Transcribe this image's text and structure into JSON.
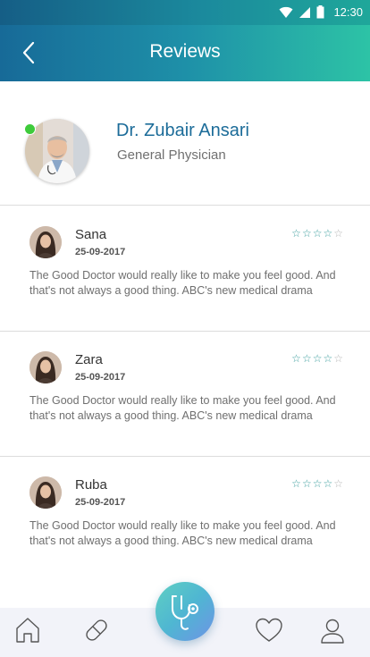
{
  "status_bar": {
    "time": "12:30",
    "icons": [
      "wifi-icon",
      "cell-signal-icon",
      "battery-icon"
    ]
  },
  "header": {
    "title": "Reviews",
    "back_icon": "chevron-left-icon"
  },
  "doctor": {
    "name": "Dr. Zubair Ansari",
    "specialty": "General Physician",
    "online": true
  },
  "reviews": [
    {
      "name": "Sana",
      "date": "25-09-2017",
      "rating": 4,
      "max_rating": 5,
      "text": "The Good Doctor would really like to make you feel good. And that's not always a good thing. ABC's new medical drama"
    },
    {
      "name": "Zara",
      "date": "25-09-2017",
      "rating": 4,
      "max_rating": 5,
      "text": "The Good Doctor would really like to make you feel good. And that's not always a good thing. ABC's new medical drama"
    },
    {
      "name": "Ruba",
      "date": "25-09-2017",
      "rating": 4,
      "max_rating": 5,
      "text": "The Good Doctor would really like to make you feel good. And that's not always a good thing. ABC's new medical drama"
    }
  ],
  "bottom_nav": {
    "items": [
      "home-icon",
      "pill-icon",
      "stethoscope-icon",
      "heart-icon",
      "profile-icon"
    ]
  },
  "colors": {
    "header_start": "#176a98",
    "header_end": "#2dc3a6",
    "doctor_name": "#1c6c99",
    "star_filled": "#3a9d9d",
    "online": "#3ecb3b",
    "nav_bg": "#f2f3f9"
  }
}
